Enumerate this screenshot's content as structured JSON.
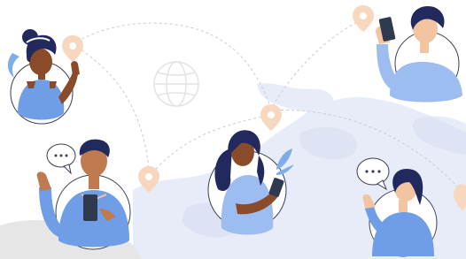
{
  "illustration": {
    "colors": {
      "background": "#ffffff",
      "map_land": "#e8ecf8",
      "map_shadow": "#d9dff2",
      "ground": "#e6e6e6",
      "connection_line": "#c9cbd2",
      "pin": "#f7d7bd",
      "pin_hole": "#ffffff",
      "globe": "#e3e3e3",
      "shirt": "#6f9ee6",
      "shirt_light": "#9dbcf0",
      "hair": "#22295c",
      "skin_dark": "#8a4b2a",
      "skin_medium": "#c07a4f",
      "skin_light": "#f3c4a2",
      "phone": "#2f3a4f",
      "leaf": "#7eaee8",
      "circle_ring": "#3a3f52",
      "bubble_border": "#3a3f52"
    },
    "icons": [
      "globe-icon",
      "location-pin-icon",
      "chat-bubble-icon",
      "smartphone-icon",
      "leaf-icon"
    ],
    "people": [
      {
        "name": "woman-waving-top-left"
      },
      {
        "name": "man-with-phone-top-right"
      },
      {
        "name": "man-with-phone-bottom-left"
      },
      {
        "name": "woman-with-phone-center"
      },
      {
        "name": "woman-waving-bottom-right"
      }
    ]
  }
}
